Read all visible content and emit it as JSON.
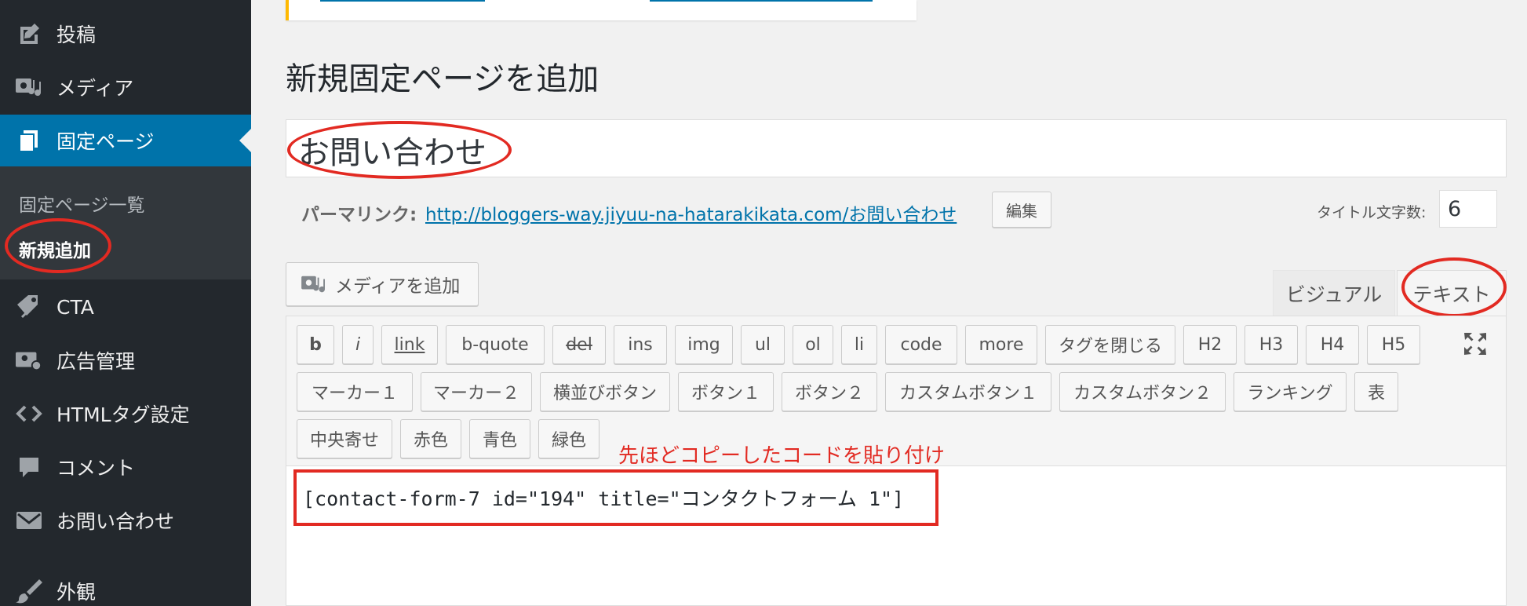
{
  "sidebar": {
    "items": [
      {
        "label": "投稿",
        "icon": "pin-icon"
      },
      {
        "label": "メディア",
        "icon": "media-icon"
      },
      {
        "label": "固定ページ",
        "icon": "pages-icon"
      },
      {
        "label": "CTA",
        "icon": "tag-icon"
      },
      {
        "label": "広告管理",
        "icon": "ads-icon"
      },
      {
        "label": "HTMLタグ設定",
        "icon": "code-icon"
      },
      {
        "label": "コメント",
        "icon": "comment-icon"
      },
      {
        "label": "お問い合わせ",
        "icon": "mail-icon"
      },
      {
        "label": "外観",
        "icon": "brush-icon"
      }
    ],
    "submenu": {
      "list": "固定ページ一覧",
      "add_new": "新規追加"
    }
  },
  "main": {
    "page_title": "新規固定ページを追加",
    "post_title": "お問い合わせ",
    "permalink_label": "パーマリンク:",
    "permalink_url": "http://bloggers-way.jiyuu-na-hatarakikata.com/お問い合わせ",
    "edit_button": "編集",
    "title_count_label": "タイトル文字数:",
    "title_count_value": "6",
    "add_media_button": "メディアを追加",
    "tab_visual": "ビジュアル",
    "tab_text": "テキスト"
  },
  "toolbar": {
    "row1": [
      "b",
      "i",
      "link",
      "b-quote",
      "del",
      "ins",
      "img",
      "ul",
      "ol",
      "li",
      "code",
      "more",
      "タグを閉じる",
      "H2",
      "H3",
      "H4",
      "H5"
    ],
    "row2": [
      "マーカー１",
      "マーカー２",
      "横並びボタン",
      "ボタン１",
      "ボタン２",
      "カスタムボタン１",
      "カスタムボタン２",
      "ランキング",
      "表"
    ],
    "row3": [
      "中央寄せ",
      "赤色",
      "青色",
      "緑色"
    ]
  },
  "annotation": "先ほどコピーしたコードを貼り付け",
  "editor_content": "[contact-form-7 id=\"194\" title=\"コンタクトフォーム 1\"]",
  "colors": {
    "sidebar_bg": "#23282d",
    "submenu_bg": "#32373c",
    "accent": "#0073aa",
    "highlight_red": "#e22a22",
    "notice_yellow": "#ffb900"
  }
}
